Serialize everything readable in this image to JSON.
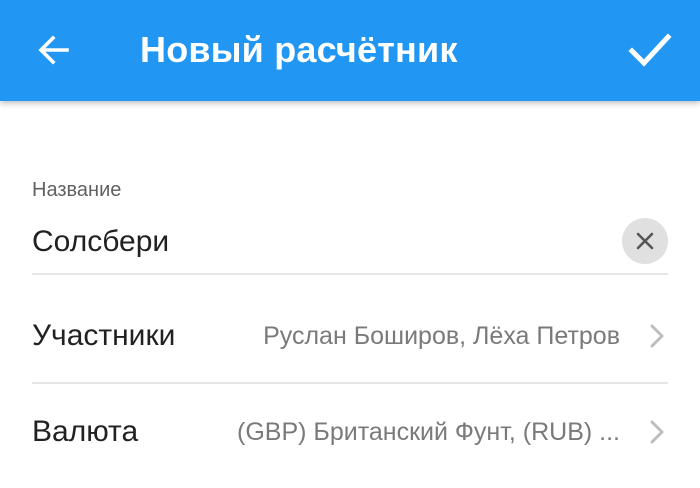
{
  "appbar": {
    "title": "Новый расчётник",
    "back_icon": "arrow-left-icon",
    "confirm_icon": "check-icon",
    "background_color": "#2196f3"
  },
  "name_field": {
    "label": "Название",
    "value": "Солсбери",
    "clear_icon": "close-icon"
  },
  "rows": [
    {
      "label": "Участники",
      "value": "Руслан Боширов, Лёха Петров",
      "icon": "chevron-right-icon"
    },
    {
      "label": "Валюта",
      "value": "(GBP) Британский Фунт, (RUB) ...",
      "icon": "chevron-right-icon"
    }
  ]
}
